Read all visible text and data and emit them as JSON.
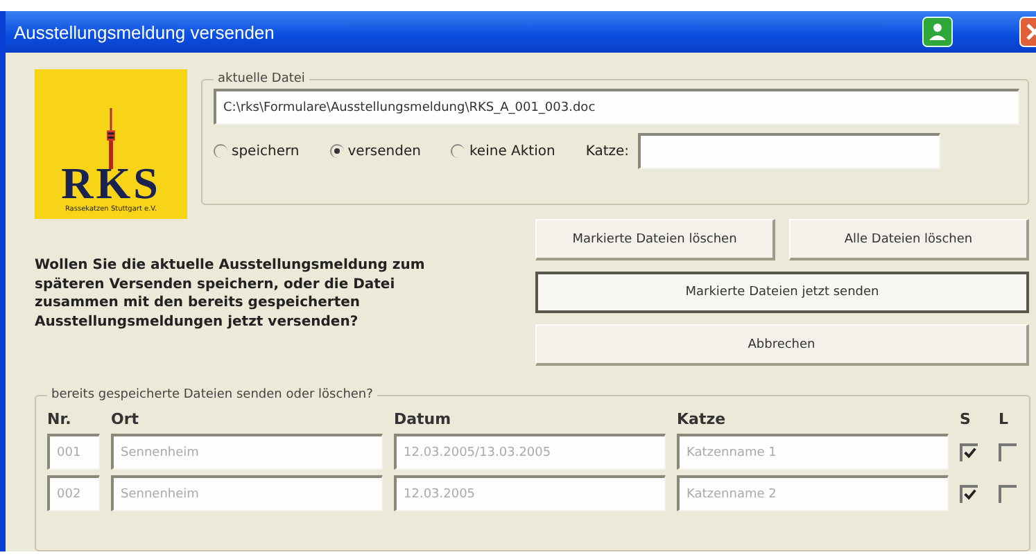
{
  "window": {
    "title": "Ausstellungsmeldung versenden"
  },
  "logo": {
    "letters": "RKS",
    "caption": "Rassekatzen Stuttgart e.V."
  },
  "current_file": {
    "legend": "aktuelle Datei",
    "path": "C:\\rks\\Formulare\\Ausstellungsmeldung\\RKS_A_001_003.doc",
    "options": [
      {
        "label": "speichern",
        "selected": false
      },
      {
        "label": "versenden",
        "selected": true
      },
      {
        "label": "keine Aktion",
        "selected": false
      }
    ],
    "cat_label": "Katze:"
  },
  "question": "Wollen Sie die aktuelle Ausstellungsmeldung zum späteren Versenden speichern, oder die Datei zusammen mit den bereits gespeicherten Ausstellungsmeldungen jetzt versenden?",
  "buttons": [
    {
      "label": "Markierte Dateien löschen",
      "default": false
    },
    {
      "label": "Alle Dateien löschen",
      "default": false
    },
    {
      "label": "Markierte Dateien jetzt senden",
      "default": true
    },
    {
      "label": "Abbrechen",
      "default": false
    }
  ],
  "saved_files": {
    "legend": "bereits gespeicherte Dateien senden oder löschen?",
    "columns": [
      "Nr.",
      "Ort",
      "Datum",
      "Katze",
      "S",
      "L"
    ],
    "rows": [
      {
        "nr": "001",
        "ort": "Sennenheim",
        "datum": "12.03.2005/13.03.2005",
        "katze": "Katzenname 1",
        "send": true,
        "delete": false
      },
      {
        "nr": "002",
        "ort": "Sennenheim",
        "datum": "12.03.2005",
        "katze": "Katzenname 2",
        "send": true,
        "delete": false
      }
    ]
  }
}
